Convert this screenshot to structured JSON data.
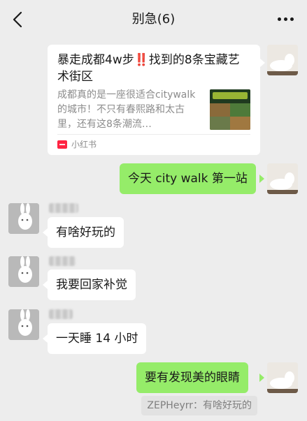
{
  "header": {
    "title": "别急(6)",
    "back_icon": "chevron-left-icon",
    "more_icon": "more-dots-icon"
  },
  "share_card": {
    "title": "暴走成都4w步‼️找到的8条宝藏艺术街区",
    "description": "成都真的是一座很适合citywalk的城市！不只有春熙路和太古里，还有这8条潮流…",
    "source": "小红书",
    "source_icon": "xiaohongshu-logo-icon"
  },
  "messages": [
    {
      "sender": "self",
      "text": "今天 city walk 第一站"
    },
    {
      "sender": "other",
      "text": "有啥好玩的"
    },
    {
      "sender": "other",
      "text": "我要回家补觉"
    },
    {
      "sender": "other",
      "text": "一天睡 14 小时"
    },
    {
      "sender": "self",
      "text": "要有发现美的眼睛"
    }
  ],
  "quote": {
    "text": "ZEPHeyrr：有啥好玩的"
  },
  "colors": {
    "background": "#ededed",
    "self_bubble": "#95ec69",
    "other_bubble": "#ffffff",
    "secondary_text": "#8c8c8c"
  }
}
